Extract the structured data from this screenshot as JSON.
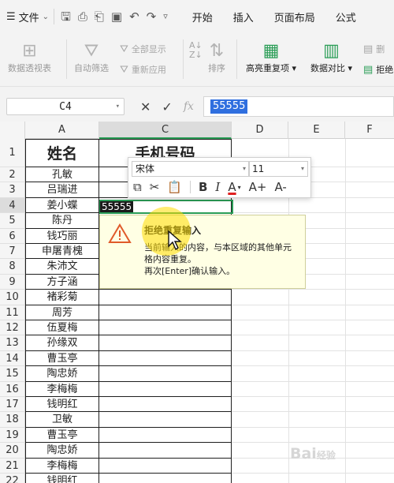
{
  "menu": {
    "file_label": "文件",
    "tabs": [
      "开始",
      "插入",
      "页面布局",
      "公式"
    ]
  },
  "ribbon": {
    "pivot_label": "数据透视表",
    "autofilter_label": "自动筛选",
    "show_all_label": "全部显示",
    "reapply_label": "重新应用",
    "sort_label": "排序",
    "highlight_dup_label": "高亮重复项",
    "data_compare_label": "数据对比",
    "reject_label": "拒绝",
    "delete_label": "删"
  },
  "formula_bar": {
    "cell_ref": "C4",
    "fx_label": "fx",
    "value": "55555"
  },
  "grid": {
    "columns": [
      "A",
      "C",
      "D",
      "E",
      "F"
    ],
    "rows": [
      "1",
      "2",
      "3",
      "4",
      "5",
      "6",
      "7",
      "8",
      "9",
      "10",
      "11",
      "12",
      "13",
      "14",
      "15",
      "16",
      "17",
      "18",
      "19",
      "20",
      "21",
      "22"
    ],
    "header_a": "姓名",
    "header_c": "手机号码",
    "names": [
      "孔敏",
      "吕瑞进",
      "姜小蝶",
      "陈丹",
      "钱巧丽",
      "申屠青槐",
      "朱沛文",
      "方子涵",
      "褚彩菊",
      "周芳",
      "伍夏梅",
      "孙缘双",
      "曹玉亭",
      "陶忠娇",
      "李梅梅",
      "钱明红",
      "卫敏",
      "曹玉亭",
      "陶忠娇",
      "李梅梅",
      "钱明红"
    ],
    "c4_value": "55555"
  },
  "mini_toolbar": {
    "font_name": "宋体",
    "font_size": "11",
    "bold": "B",
    "italic": "I",
    "font_color": "A",
    "grow": "A+",
    "shrink": "A-"
  },
  "popup": {
    "title": "拒绝重复输入",
    "line1": "当前输入的内容，与本区域的其他单元",
    "line2": "格内容重复。",
    "line3": "再次[Enter]确认输入。"
  },
  "watermark": {
    "text": "Bai",
    "suffix": "经验"
  },
  "colors": {
    "accent": "#2a9d56",
    "selection_blue": "#2f6fdf",
    "popup_bg": "#ffffe4",
    "warning": "#e05a2a"
  }
}
